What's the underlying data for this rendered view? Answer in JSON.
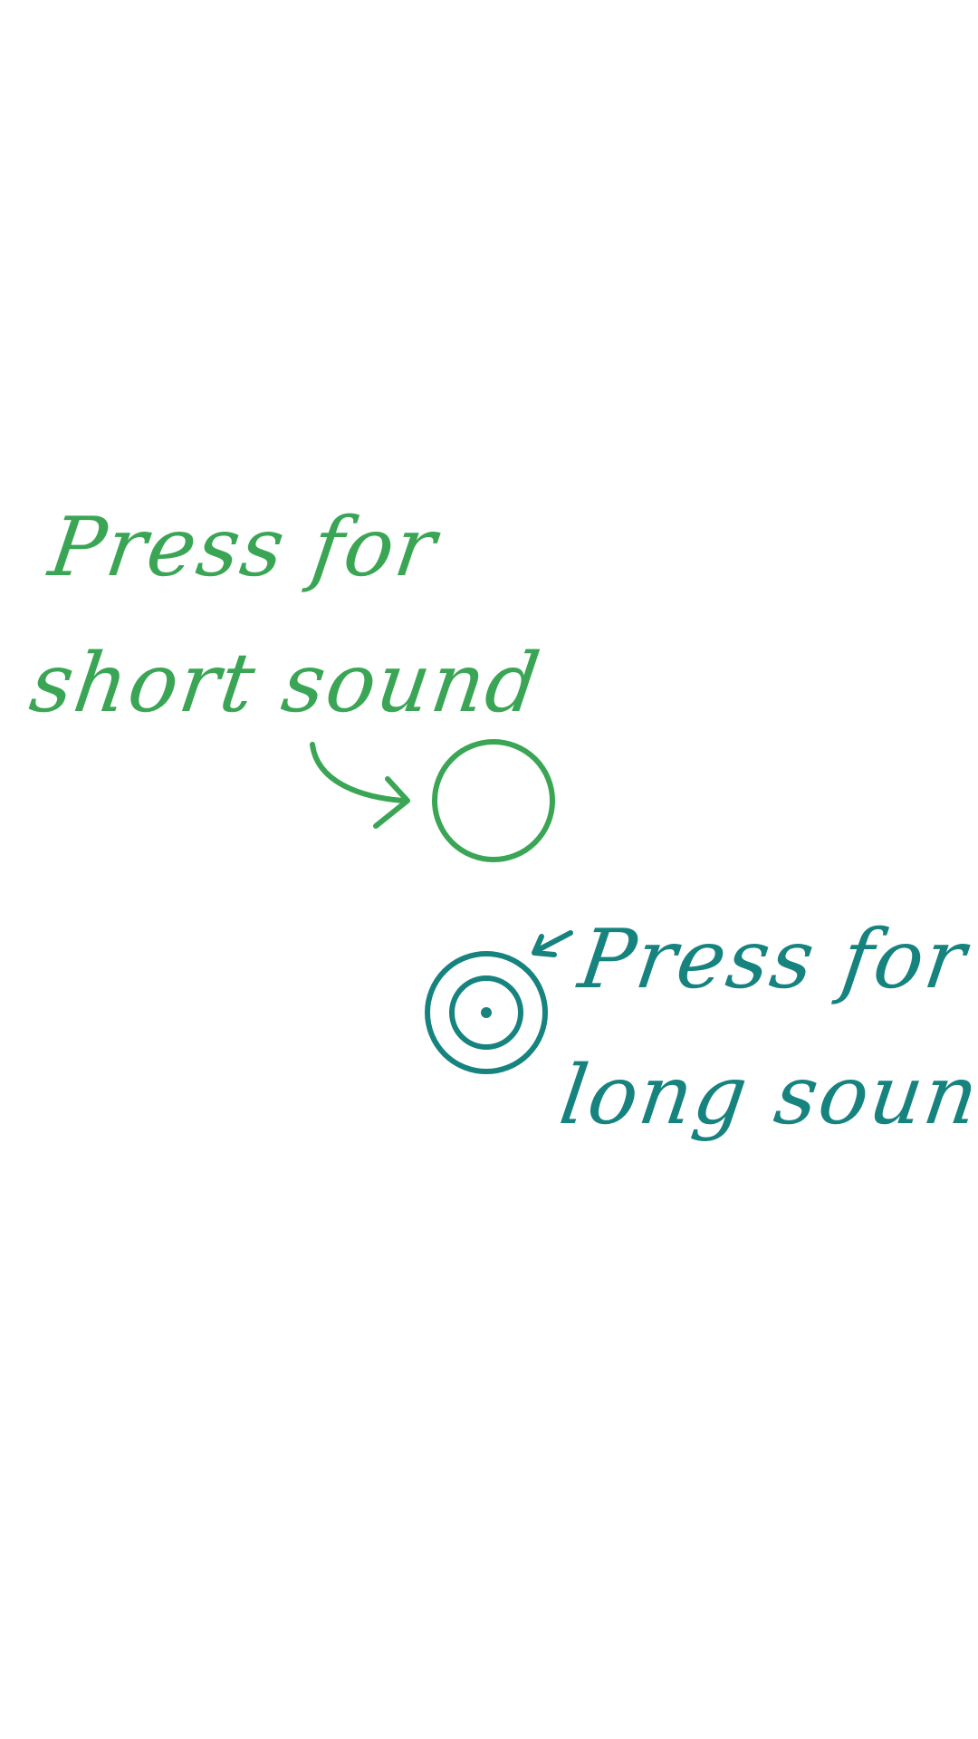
{
  "colors": {
    "short_accent": "#3aa655",
    "long_accent": "#16837f",
    "background": "#ffffff"
  },
  "short_hint": {
    "line1": "Press for",
    "line2": "short sound"
  },
  "long_hint": {
    "line1": "Press for",
    "line2": "long sound"
  },
  "icons": {
    "short_button": "single-circle-icon",
    "long_button": "concentric-circles-icon",
    "short_pointer": "curved-arrow-icon",
    "long_pointer": "short-arrow-icon"
  }
}
